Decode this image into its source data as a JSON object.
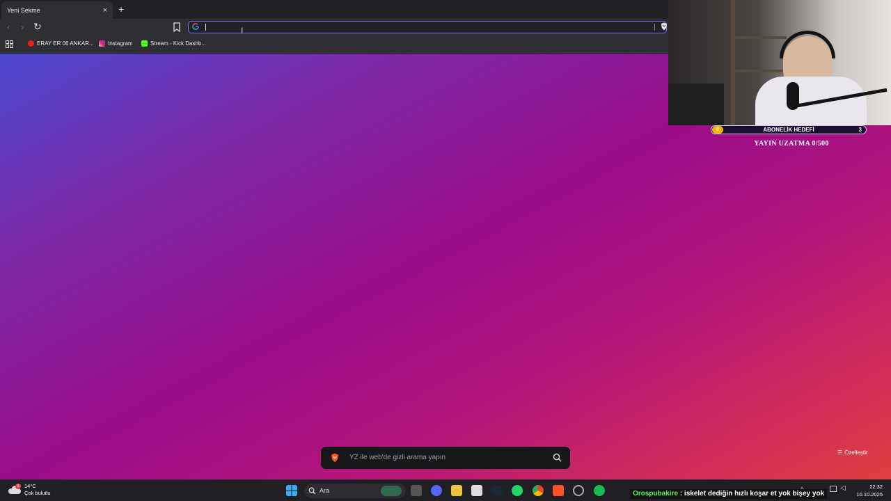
{
  "tab": {
    "title": "Yeni Sekme",
    "close": "×",
    "new_tab": "+"
  },
  "toolbar": {
    "back": "‹",
    "forward": "›",
    "reload": "↻",
    "omnibox_value": ""
  },
  "bookmarks": [
    {
      "label": "ERAY ER 06 ANKAR...",
      "icon": "youtube-icon",
      "color": "#e62117"
    },
    {
      "label": "Instagram",
      "icon": "instagram-icon",
      "color": "#d62976"
    },
    {
      "label": "Stream - Kick Dashb...",
      "icon": "kick-icon",
      "color": "#53fc18"
    }
  ],
  "overlay": {
    "goal_title": "ABONELİK HEDEFİ",
    "goal_current": "0",
    "goal_target": "3",
    "goal_progress": 0,
    "extension": "YAYIN UZATMA 0/500"
  },
  "search": {
    "placeholder": "YZ ile web'de gizli arama yapın"
  },
  "customize": {
    "label": "Özelleştir"
  },
  "taskbar": {
    "weather_temp": "14°C",
    "weather_desc": "Çok bulutlu",
    "weather_badge": "1",
    "search_label": "Ara",
    "time": "22:32",
    "date": "10.10.2025"
  },
  "chat": {
    "user": "Orospubakire",
    "separator": " : ",
    "message": "iskelet dediğin hızlı koşar et yok bişey yok"
  },
  "colors": {
    "accent": "#7c6cf0",
    "gradient_start": "#4b4ad0",
    "gradient_mid": "#9a0c8a",
    "gradient_end": "#dd4040"
  }
}
